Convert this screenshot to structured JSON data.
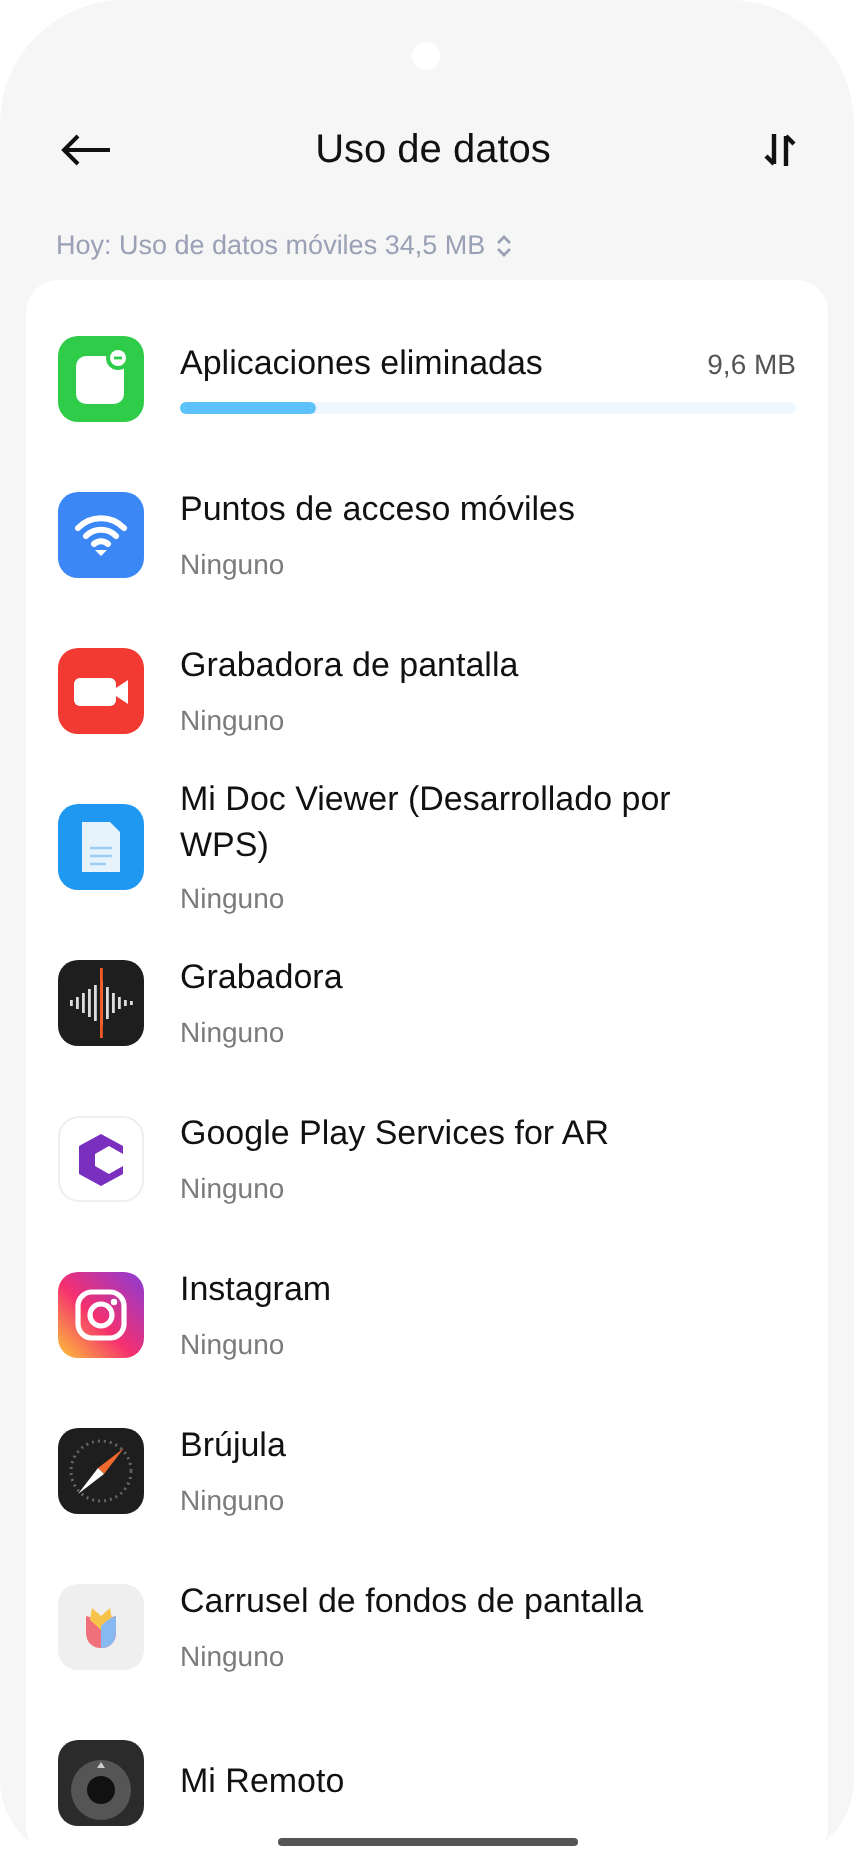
{
  "header": {
    "title": "Uso de datos"
  },
  "summary": {
    "text": "Hoy: Uso de datos móviles 34,5 MB"
  },
  "apps": [
    {
      "name": "Aplicaciones eliminadas",
      "usage": "9,6 MB",
      "level": 0.22
    },
    {
      "name": "Puntos de acceso móviles",
      "subtitle": "Ninguno"
    },
    {
      "name": "Grabadora de pantalla",
      "subtitle": "Ninguno"
    },
    {
      "name": "Mi Doc Viewer (Desarrollado por WPS)",
      "subtitle": "Ninguno"
    },
    {
      "name": "Grabadora",
      "subtitle": "Ninguno"
    },
    {
      "name": "Google Play Services for AR",
      "subtitle": "Ninguno"
    },
    {
      "name": "Instagram",
      "subtitle": "Ninguno"
    },
    {
      "name": "Brújula",
      "subtitle": "Ninguno"
    },
    {
      "name": "Carrusel de fondos de pantalla",
      "subtitle": "Ninguno"
    },
    {
      "name": "Mi Remoto"
    }
  ]
}
